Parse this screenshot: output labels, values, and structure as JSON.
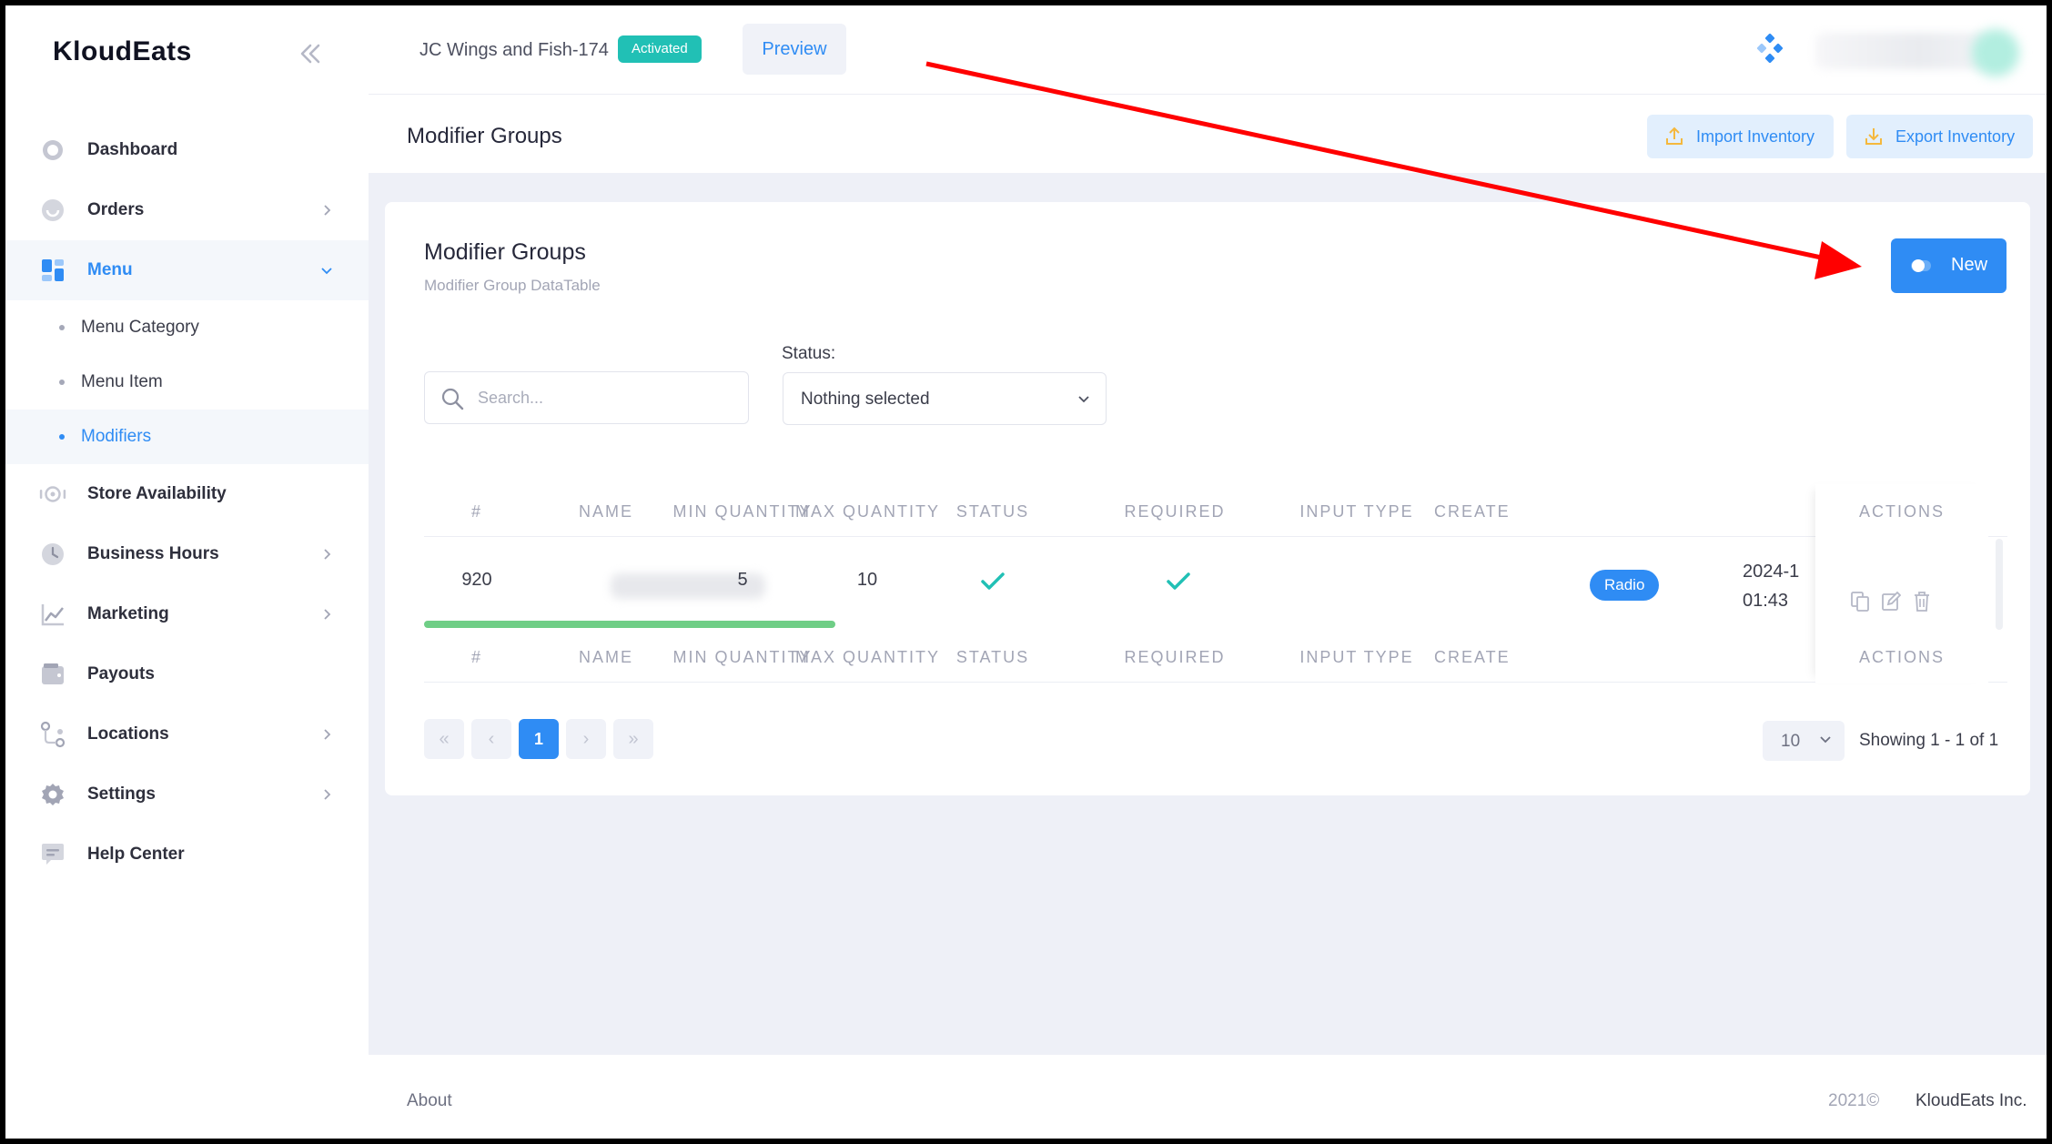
{
  "app": {
    "brand": "KloudEats"
  },
  "sidebar": {
    "items": [
      {
        "label": "Dashboard",
        "icon": "dashboard-icon",
        "has_arrow": false
      },
      {
        "label": "Orders",
        "icon": "orders-icon",
        "has_arrow": true
      },
      {
        "label": "Menu",
        "icon": "menu-icon",
        "has_arrow": true,
        "active": true
      },
      {
        "label": "Store Availability",
        "icon": "store-availability-icon",
        "has_arrow": false
      },
      {
        "label": "Business Hours",
        "icon": "clock-icon",
        "has_arrow": true
      },
      {
        "label": "Marketing",
        "icon": "chart-icon",
        "has_arrow": true
      },
      {
        "label": "Payouts",
        "icon": "wallet-icon",
        "has_arrow": false
      },
      {
        "label": "Locations",
        "icon": "locations-icon",
        "has_arrow": true
      },
      {
        "label": "Settings",
        "icon": "gear-icon",
        "has_arrow": true
      },
      {
        "label": "Help Center",
        "icon": "help-icon",
        "has_arrow": false
      }
    ],
    "menu_sub": [
      {
        "label": "Menu Category"
      },
      {
        "label": "Menu Item"
      },
      {
        "label": "Modifiers",
        "active": true
      }
    ]
  },
  "header": {
    "store_name": "JC Wings and Fish-174",
    "status_badge": "Activated",
    "preview_label": "Preview"
  },
  "subheader": {
    "title": "Modifier Groups",
    "import_label": "Import Inventory",
    "export_label": "Export Inventory"
  },
  "card": {
    "title": "Modifier Groups",
    "subtitle": "Modifier Group DataTable",
    "new_label": "New",
    "search_placeholder": "Search...",
    "status_label": "Status:",
    "status_value": "Nothing selected"
  },
  "table": {
    "columns": [
      "#",
      "NAME",
      "MIN QUANTITY",
      "MAX QUANTITY",
      "STATUS",
      "REQUIRED",
      "INPUT TYPE",
      "CREATE",
      "ACTIONS"
    ],
    "rows": [
      {
        "id": "920",
        "min": "5",
        "max": "10",
        "status": true,
        "required": true,
        "input_type": "Radio",
        "created_date": "2024-1",
        "created_time": "01:43"
      }
    ]
  },
  "pagination": {
    "current_page": "1",
    "per_page": "10",
    "showing": "Showing 1 - 1 of 1"
  },
  "footer": {
    "about": "About",
    "year": "2021©",
    "company": "KloudEats Inc."
  },
  "colors": {
    "accent": "#2f8cf4",
    "activated": "#21c0b5",
    "check": "#21c0b5",
    "annotation_arrow": "#ff0000"
  }
}
